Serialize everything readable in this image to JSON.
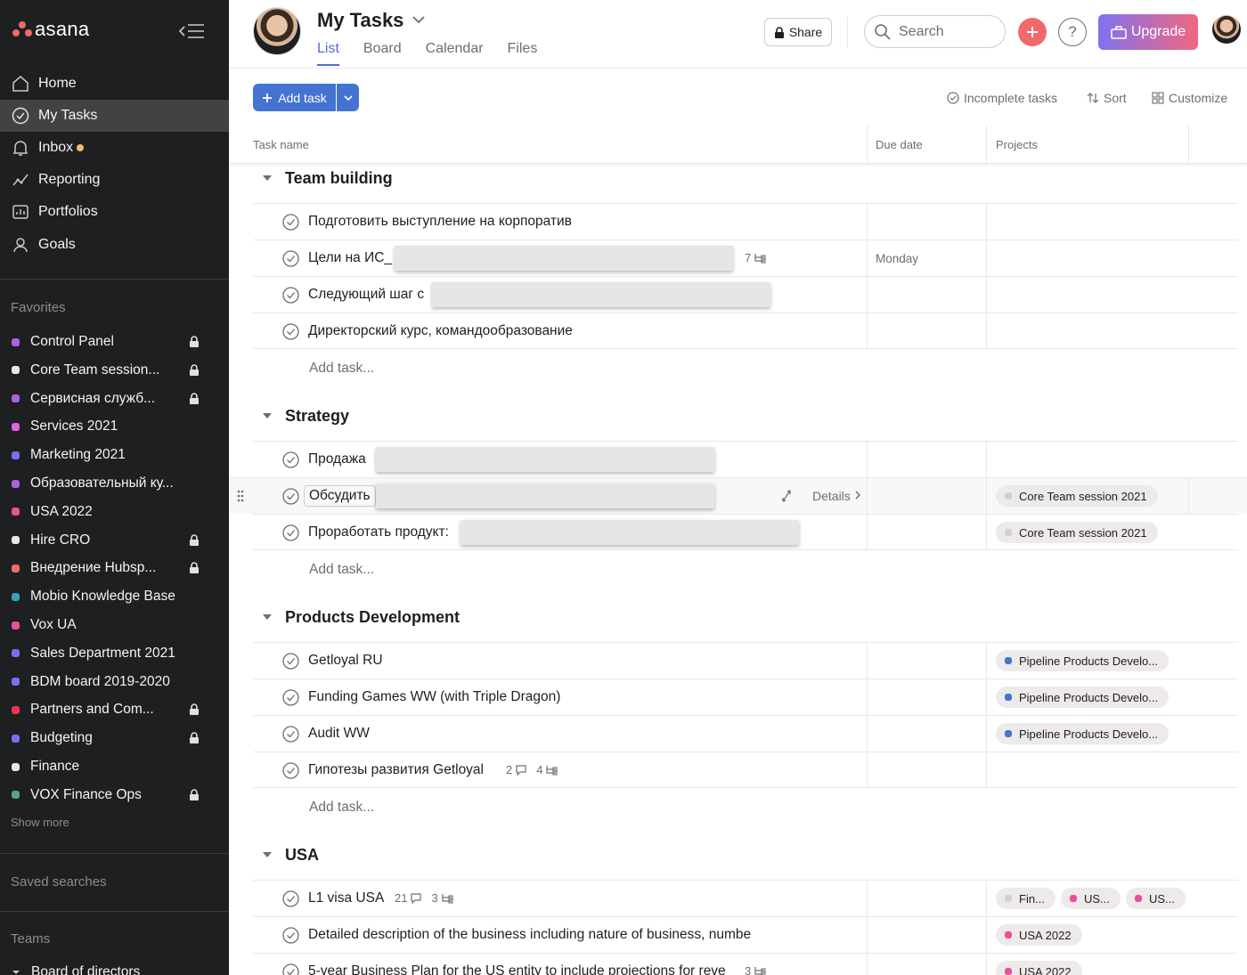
{
  "sidebar": {
    "logo": "asana",
    "nav": [
      {
        "label": "Home",
        "icon": "home-icon",
        "active": false
      },
      {
        "label": "My Tasks",
        "icon": "check-circle-icon",
        "active": true
      },
      {
        "label": "Inbox",
        "icon": "bell-icon",
        "active": false
      },
      {
        "label": "Reporting",
        "icon": "chart-line-icon",
        "active": false
      },
      {
        "label": "Portfolios",
        "icon": "portfolio-icon",
        "active": false
      },
      {
        "label": "Goals",
        "icon": "person-icon",
        "active": false
      }
    ],
    "favorites_label": "Favorites",
    "favorites": [
      {
        "label": "Control Panel",
        "color": "#aa62e3",
        "locked": true
      },
      {
        "label": "Core Team session...",
        "color": "#e8e8e8",
        "locked": true
      },
      {
        "label": "Сервисная служб...",
        "color": "#aa62e3",
        "locked": true
      },
      {
        "label": "Services 2021",
        "color": "#e362e3",
        "locked": false
      },
      {
        "label": "Marketing 2021",
        "color": "#7a6ff0",
        "locked": false
      },
      {
        "label": "Образовательный ку...",
        "color": "#aa62e3",
        "locked": false
      },
      {
        "label": "USA 2022",
        "color": "#ea4e9d",
        "locked": false
      },
      {
        "label": "Hire CRO",
        "color": "#e8e8e8",
        "locked": true
      },
      {
        "label": "Внедрение Hubsp...",
        "color": "#f06a6a",
        "locked": true
      },
      {
        "label": "Mobio Knowledge Base",
        "color": "#37a5b5",
        "locked": false
      },
      {
        "label": "Vox UA",
        "color": "#ea4e9d",
        "locked": false
      },
      {
        "label": "Sales Department 2021",
        "color": "#7a6ff0",
        "locked": false
      },
      {
        "label": "BDM board 2019-2020",
        "color": "#7a6ff0",
        "locked": false
      },
      {
        "label": "Partners and Com...",
        "color": "#e8384f",
        "locked": true
      },
      {
        "label": "Budgeting",
        "color": "#7a6ff0",
        "locked": true
      },
      {
        "label": "Finance",
        "color": "#e8e8e8",
        "locked": false
      },
      {
        "label": "VOX Finance Ops",
        "color": "#5da283",
        "locked": true
      }
    ],
    "show_more": "Show more",
    "saved_searches": "Saved searches",
    "teams": "Teams",
    "team_partial": "Board of directors"
  },
  "header": {
    "title": "My Tasks",
    "tabs": [
      "List",
      "Board",
      "Calendar",
      "Files"
    ],
    "active_tab": "List",
    "share": "Share",
    "search_placeholder": "Search",
    "help": "?",
    "upgrade": "Upgrade"
  },
  "toolbar": {
    "add_task": "Add task",
    "incomplete": "Incomplete tasks",
    "sort": "Sort",
    "customize": "Customize"
  },
  "columns": [
    "Task name",
    "Due date",
    "Projects"
  ],
  "add_task_link": "Add task...",
  "sections": [
    {
      "title": "Team building",
      "tasks": [
        {
          "name": "Подготовить выступление на корпоратив"
        },
        {
          "name": "Цели на ИС_",
          "subtasks": "7",
          "due": "Monday"
        },
        {
          "name": "Следующий шаг с"
        },
        {
          "name": "Директорский курс, командообразование"
        }
      ]
    },
    {
      "title": "Strategy",
      "tasks": [
        {
          "name": "Продажа"
        },
        {
          "name": "Обсудить",
          "details": "Details",
          "projects": [
            {
              "label": "Core Team session 2021",
              "color": "#d0d0d0"
            }
          ]
        },
        {
          "name": "Проработать продукт:",
          "projects": [
            {
              "label": "Core Team session 2021",
              "color": "#d0d0d0"
            }
          ]
        }
      ]
    },
    {
      "title": "Products Development",
      "tasks": [
        {
          "name": "Getloyal RU",
          "projects": [
            {
              "label": "Pipeline Products Develo...",
              "color": "#4573d2"
            }
          ]
        },
        {
          "name": "Funding Games WW (with Triple Dragon)",
          "projects": [
            {
              "label": "Pipeline Products Develo...",
              "color": "#4573d2"
            }
          ]
        },
        {
          "name": "Audit WW",
          "projects": [
            {
              "label": "Pipeline Products Develo...",
              "color": "#4573d2"
            }
          ]
        },
        {
          "name": "Гипотезы развития Getloyal",
          "comments": "2",
          "subtasks": "4"
        }
      ]
    },
    {
      "title": "USA",
      "tasks": [
        {
          "name": "L1 visa USA",
          "comments": "21",
          "subtasks": "3",
          "projects": [
            {
              "label": "Fin...",
              "color": "#d0d0d0"
            },
            {
              "label": "US...",
              "color": "#ea4e9d"
            },
            {
              "label": "US...",
              "color": "#ea4e9d"
            }
          ]
        },
        {
          "name": "Detailed description of the business including nature of business, numbe",
          "projects": [
            {
              "label": "USA 2022",
              "color": "#ea4e9d"
            }
          ]
        },
        {
          "name": "5-year Business Plan for the US entity to include projections for reve",
          "subtasks": "3",
          "projects": [
            {
              "label": "USA 2022",
              "color": "#ea4e9d"
            }
          ]
        }
      ]
    }
  ],
  "colors": {
    "sidebar_bg": "#1e1f21",
    "accent_blue": "#4573d2",
    "brand_coral": "#f06a6a"
  }
}
